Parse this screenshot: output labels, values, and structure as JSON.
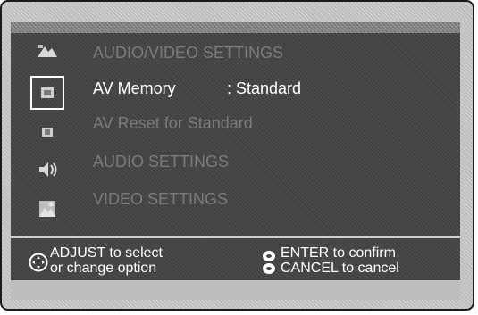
{
  "menu": {
    "title": "AUDIO/VIDEO SETTINGS",
    "rows": [
      {
        "label": "AV Memory",
        "value": ": Standard",
        "state": "selected"
      },
      {
        "label": "AV Reset for Standard",
        "value": "",
        "state": "dim"
      },
      {
        "label": "AUDIO SETTINGS",
        "value": "",
        "state": "dim"
      },
      {
        "label": "VIDEO SETTINGS",
        "value": "",
        "state": "dim"
      }
    ]
  },
  "icons": [
    "av-settings-icon",
    "av-memory-icon",
    "av-reset-icon",
    "audio-settings-icon",
    "video-settings-icon"
  ],
  "footer": {
    "adjust_line1": "ADJUST  to select",
    "adjust_line2": "or change option",
    "enter_line": "ENTER to confirm",
    "cancel_line": "CANCEL to cancel"
  },
  "colors": {
    "panel_bg": "#4a4a4a",
    "frame_bg": "#bdbdbd",
    "text_active": "#ffffff",
    "text_dim": "#8e8e8e",
    "selection_border": "#ffffff"
  }
}
